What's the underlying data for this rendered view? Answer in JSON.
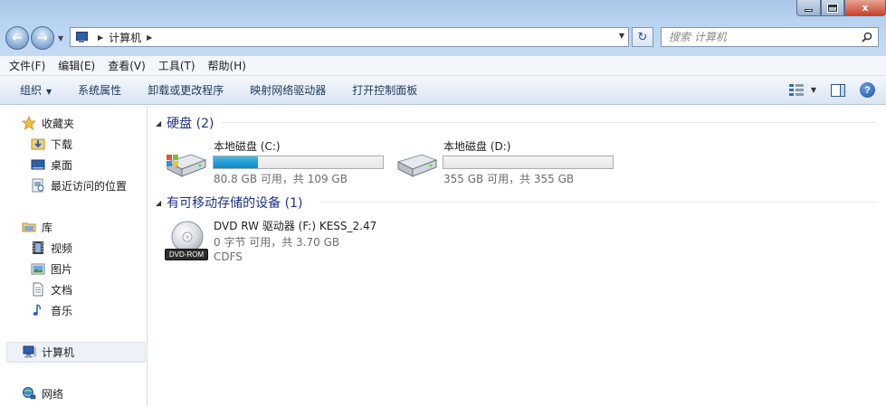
{
  "window": {
    "minimize": "",
    "maximize": "",
    "close": "x"
  },
  "address": {
    "location": "计算机",
    "search_placeholder": "搜索 计算机"
  },
  "menu": [
    "文件(F)",
    "编辑(E)",
    "查看(V)",
    "工具(T)",
    "帮助(H)"
  ],
  "toolbar": {
    "organize": "组织",
    "system_properties": "系统属性",
    "uninstall": "卸载或更改程序",
    "map_drive": "映射网络驱动器",
    "control_panel": "打开控制面板"
  },
  "sidebar": {
    "favorites": "收藏夹",
    "downloads": "下载",
    "desktop": "桌面",
    "recent": "最近访问的位置",
    "libraries": "库",
    "videos": "视频",
    "pictures": "图片",
    "documents": "文档",
    "music": "音乐",
    "computer": "计算机",
    "network": "网络"
  },
  "groups": {
    "hard_disks": "硬盘 (2)",
    "removable": "有可移动存储的设备 (1)"
  },
  "drives": [
    {
      "name": "本地磁盘 (C:)",
      "usage": "80.8 GB 可用，共 109 GB",
      "used_fraction": 0.26
    },
    {
      "name": "本地磁盘 (D:)",
      "usage": "355 GB 可用，共 355 GB",
      "used_fraction": 0.0
    }
  ],
  "dvd": {
    "name": "DVD RW 驱动器 (F:) KESS_2.47",
    "usage": "0 字节 可用，共 3.70 GB",
    "fs": "CDFS",
    "badge": "DVD-ROM"
  },
  "colors": {
    "accent": "#26a0da",
    "header": "#1e3287"
  }
}
